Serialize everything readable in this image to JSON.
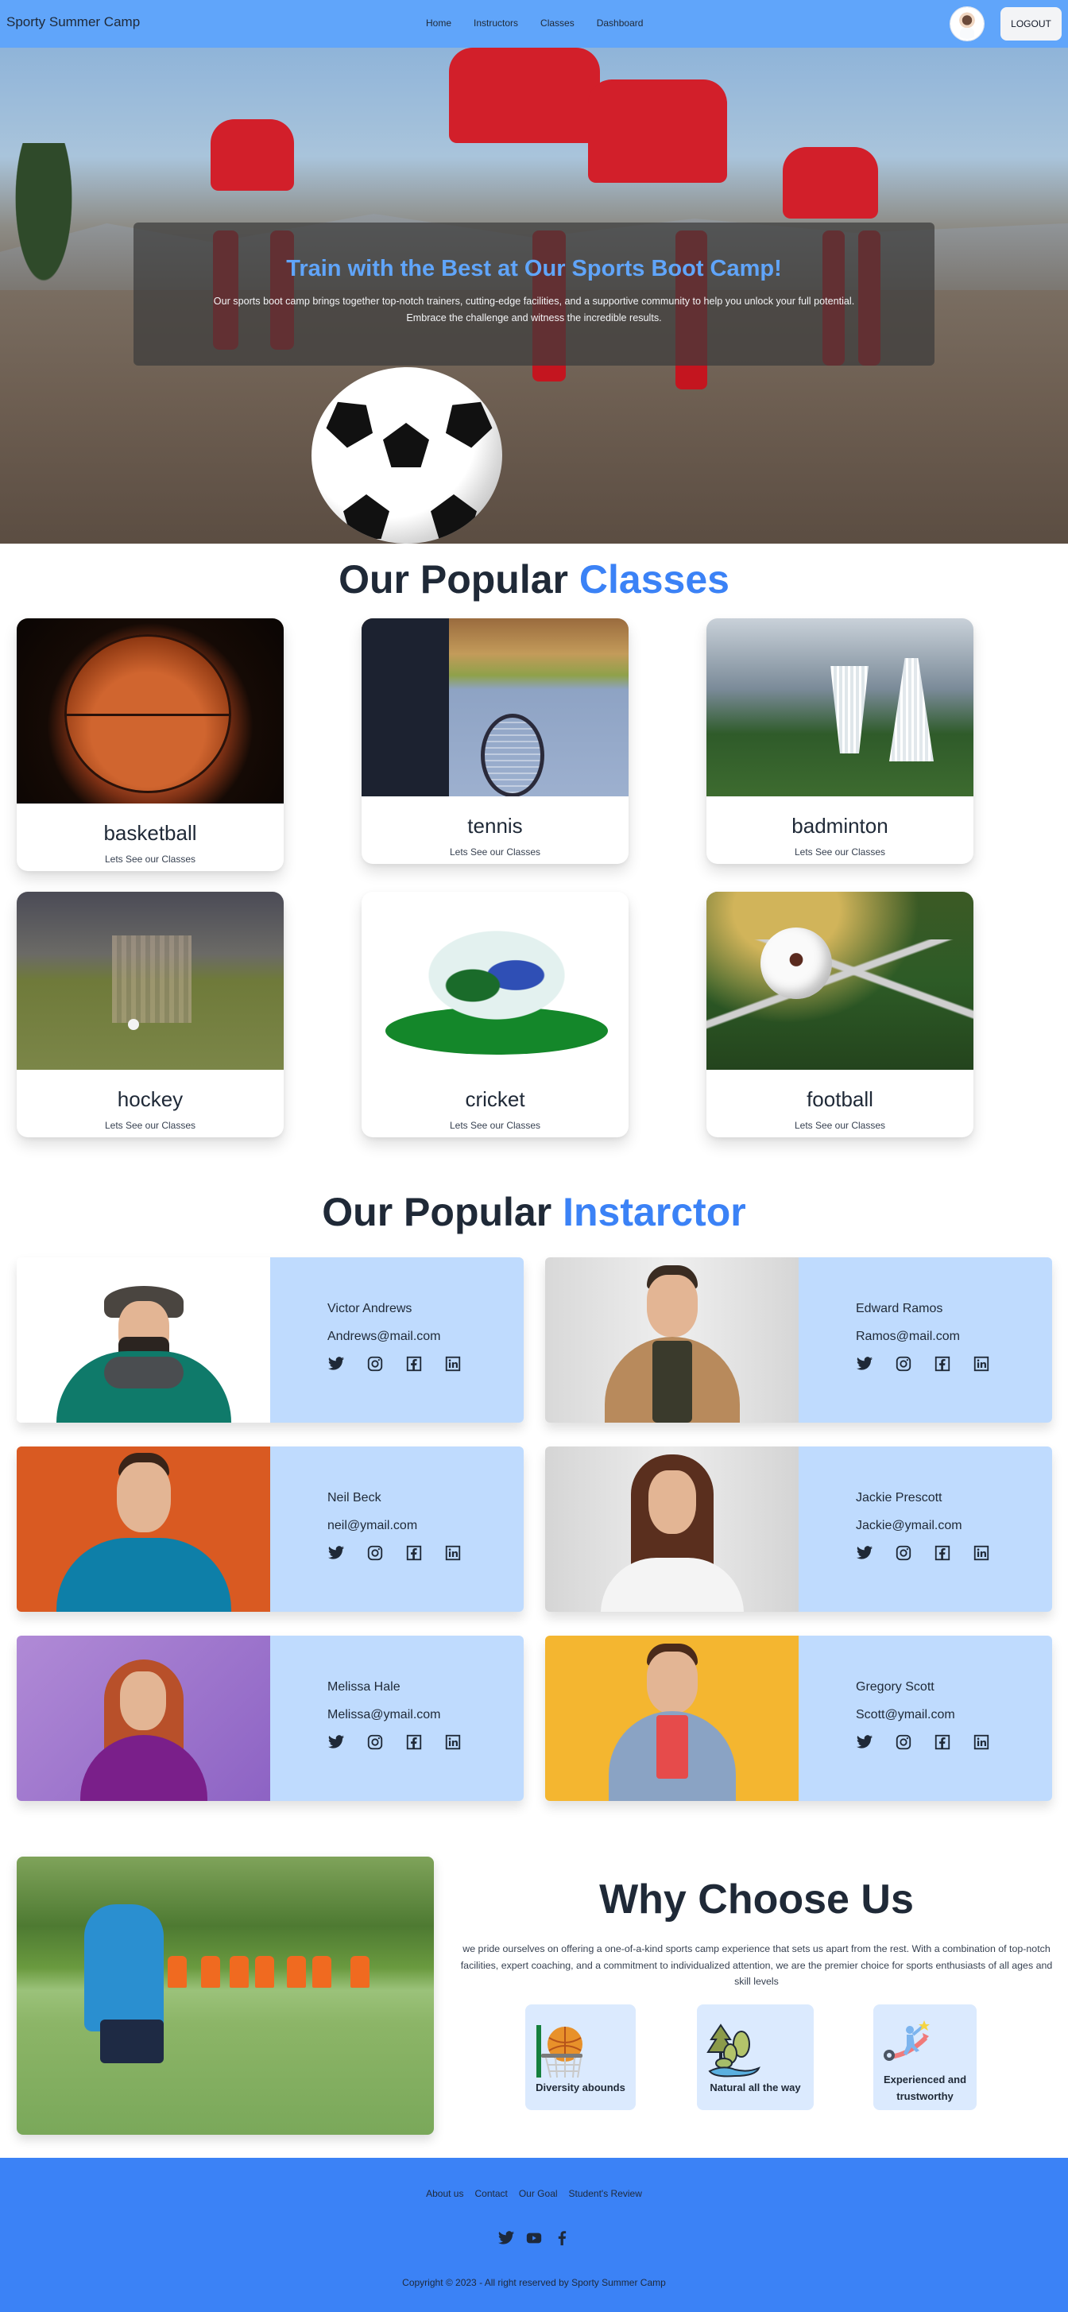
{
  "navbar": {
    "brand": "Sporty Summer Camp",
    "links": [
      "Home",
      "Instructors",
      "Classes",
      "Dashboard"
    ],
    "logout_label": "LOGOUT"
  },
  "hero": {
    "title": "Train with the Best at Our Sports Boot Camp!",
    "text_line1": "Our sports boot camp brings together top-notch trainers, cutting-edge facilities, and a supportive community to help you unlock your full potential.",
    "text_line2": "Embrace the challenge and witness the incredible results."
  },
  "classes": {
    "heading_prefix": "Our Popular",
    "heading_accent": "Classes",
    "items": [
      {
        "name": "basketball",
        "subtitle": "Lets See our Classes"
      },
      {
        "name": "tennis",
        "subtitle": "Lets See our Classes"
      },
      {
        "name": "badminton",
        "subtitle": "Lets See our Classes"
      },
      {
        "name": "hockey",
        "subtitle": "Lets See our Classes"
      },
      {
        "name": "cricket",
        "subtitle": "Lets See our Classes"
      },
      {
        "name": "football",
        "subtitle": "Lets See our Classes"
      }
    ]
  },
  "instructors": {
    "heading_prefix": "Our Popular",
    "heading_accent": "Instarctor",
    "items": [
      {
        "name": "Victor Andrews",
        "email": "Andrews@mail.com"
      },
      {
        "name": "Edward Ramos",
        "email": "Ramos@mail.com"
      },
      {
        "name": "Neil Beck",
        "email": "neil@ymail.com"
      },
      {
        "name": "Jackie Prescott",
        "email": "Jackie@ymail.com"
      },
      {
        "name": "Melissa Hale",
        "email": "Melissa@ymail.com"
      },
      {
        "name": "Gregory Scott",
        "email": "Scott@ymail.com"
      }
    ],
    "social_icons": [
      "twitter-icon",
      "instagram-icon",
      "facebook-icon",
      "linkedin-icon"
    ]
  },
  "why": {
    "title": "Why Choose Us",
    "text": "we pride ourselves on offering a one-of-a-kind sports camp experience that sets us apart from the rest. With a combination of top-notch facilities, expert coaching, and a commitment to individualized attention, we are the premier choice for sports enthusiasts of all ages and skill levels",
    "features": [
      {
        "label": "Diversity abounds",
        "icon": "basketball-hoop-icon"
      },
      {
        "label": "Natural all the way",
        "icon": "nature-trees-icon"
      },
      {
        "label_line1": "Experienced and",
        "label_line2": "trustworthy",
        "icon": "career-growth-icon"
      }
    ]
  },
  "footer": {
    "links": [
      "About us",
      "Contact",
      "Our Goal",
      "Student's Review"
    ],
    "social_icons": [
      "twitter-icon",
      "youtube-icon",
      "facebook-icon"
    ],
    "copyright": "Copyright © 2023 - All right reserved by Sporty Summer Camp"
  },
  "colors": {
    "navbar": "#60a5fa",
    "accent": "#3b82f6",
    "instructor_panel": "#bfdbfe",
    "feature_card": "#dbeafe",
    "footer": "#3b82f6",
    "text_dark": "#1f2937"
  }
}
